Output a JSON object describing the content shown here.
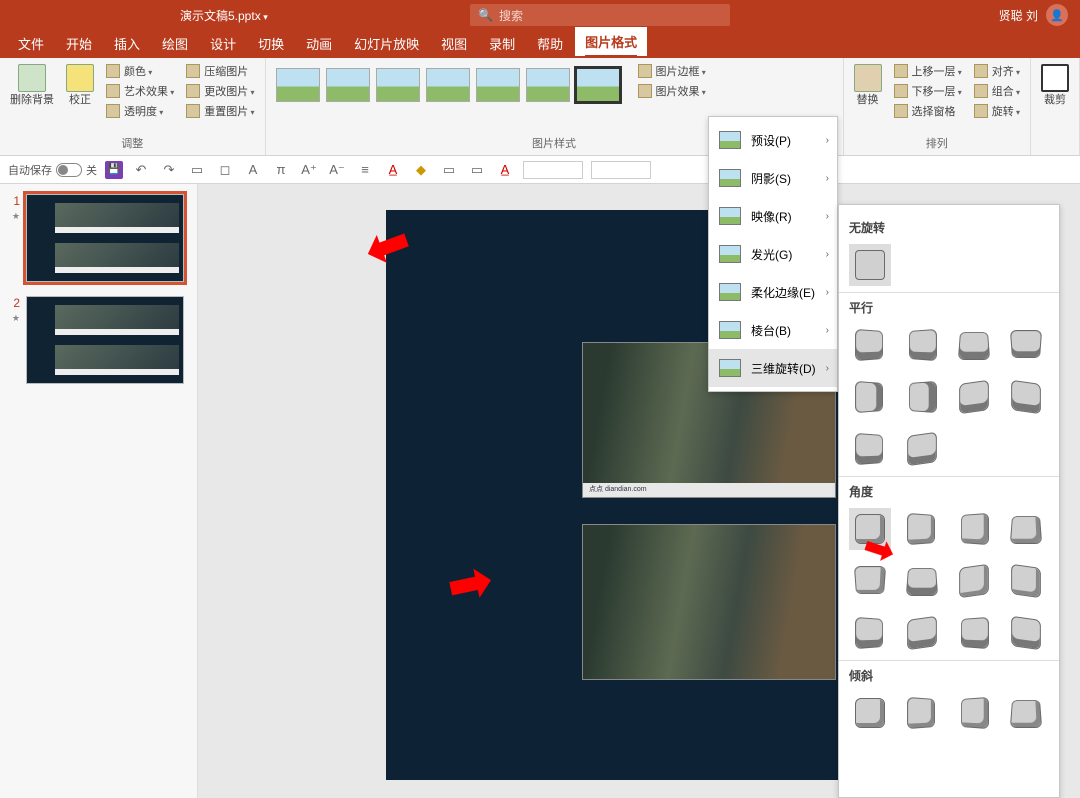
{
  "titlebar": {
    "doc_title": "演示文稿5.pptx",
    "search_placeholder": "搜索",
    "user_name": "贤聪 刘"
  },
  "tabs": {
    "items": [
      "文件",
      "开始",
      "插入",
      "绘图",
      "设计",
      "切换",
      "动画",
      "幻灯片放映",
      "视图",
      "录制",
      "帮助",
      "图片格式"
    ],
    "active_index": 11
  },
  "ribbon": {
    "adjust": {
      "label": "调整",
      "remove_bg": "删除背景",
      "corrections": "校正",
      "color": "颜色",
      "artistic": "艺术效果",
      "transparency": "透明度",
      "compress": "压缩图片",
      "change_pic": "更改图片",
      "reset_pic": "重置图片"
    },
    "styles": {
      "label": "图片样式",
      "border": "图片边框",
      "effects": "图片效果"
    },
    "arrange": {
      "label": "排列",
      "replace": "替换",
      "bring_fwd": "上移一层",
      "send_back": "下移一层",
      "selection": "选择窗格",
      "align": "对齐",
      "group": "组合",
      "rotate": "旋转"
    },
    "crop": {
      "label": "裁剪"
    }
  },
  "qat": {
    "autosave": "自动保存",
    "autosave_state": "关"
  },
  "thumbs": {
    "slides": [
      {
        "num": "1"
      },
      {
        "num": "2"
      }
    ]
  },
  "canvas": {
    "watermark": "点点 diandian.com"
  },
  "fx_menu": {
    "items": [
      {
        "label": "预设(P)"
      },
      {
        "label": "阴影(S)"
      },
      {
        "label": "映像(R)"
      },
      {
        "label": "发光(G)"
      },
      {
        "label": "柔化边缘(E)"
      },
      {
        "label": "棱台(B)"
      },
      {
        "label": "三维旋转(D)"
      }
    ],
    "hovered_index": 6
  },
  "rotation_panel": {
    "sect_none": "无旋转",
    "sect_parallel": "平行",
    "sect_perspective": "角度",
    "sect_oblique": "倾斜"
  }
}
